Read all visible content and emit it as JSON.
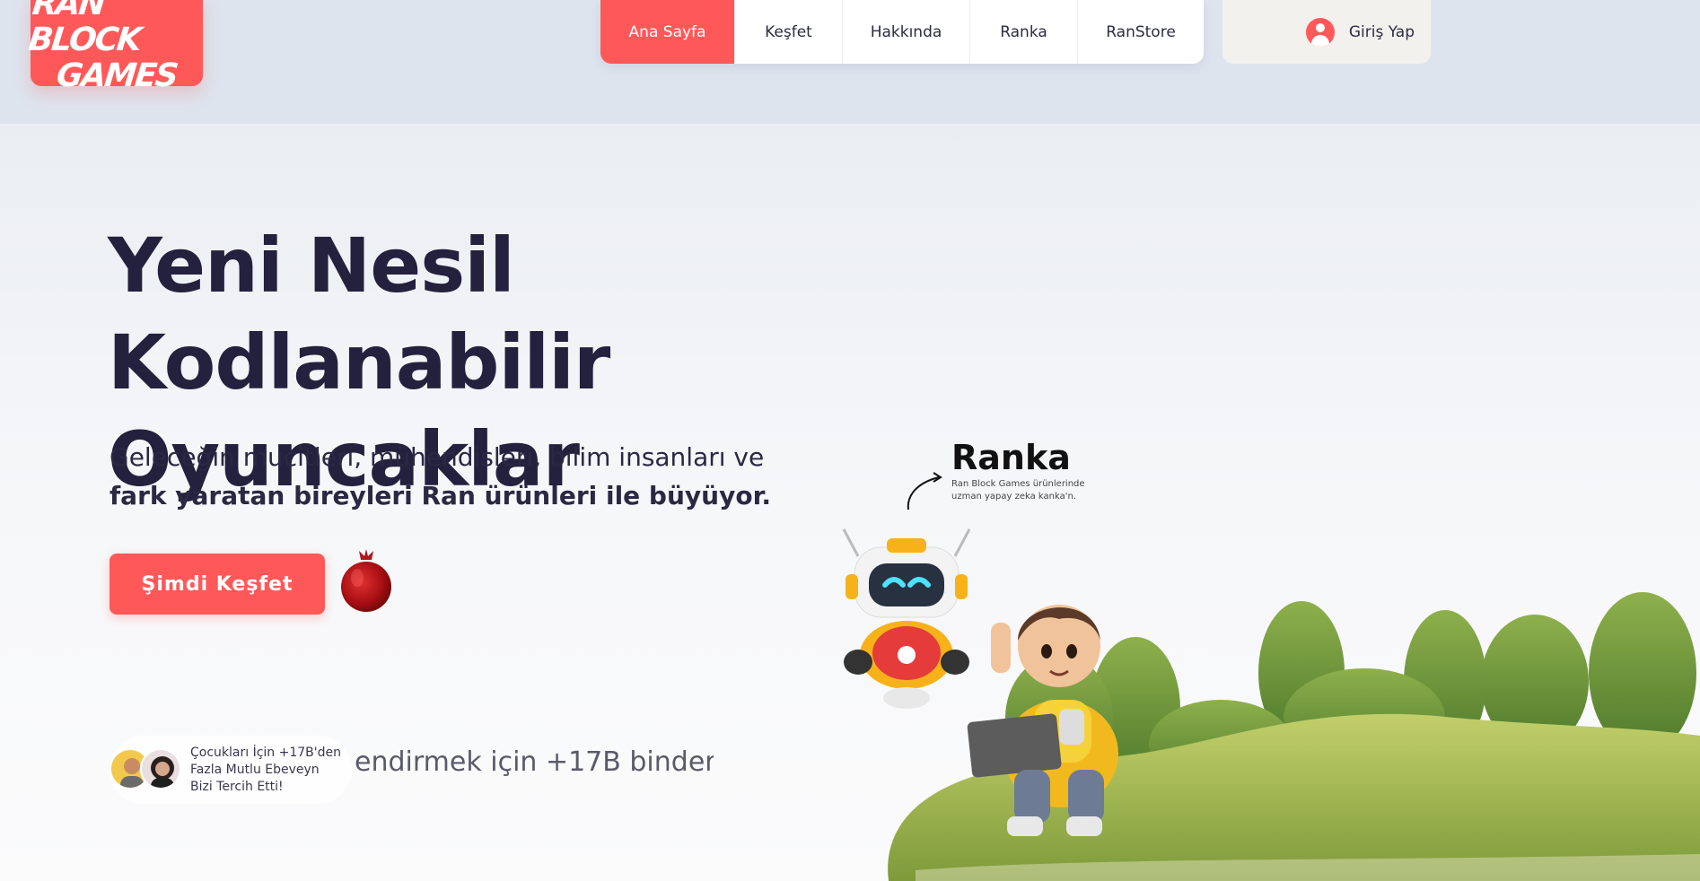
{
  "brand": {
    "line1": "RAN BLOCK",
    "line2": "GAMES"
  },
  "nav": {
    "items": [
      {
        "label": "Ana Sayfa",
        "active": true
      },
      {
        "label": "Keşfet",
        "active": false
      },
      {
        "label": "Hakkında",
        "active": false
      },
      {
        "label": "Ranka",
        "active": false
      },
      {
        "label": "RanStore",
        "active": false
      }
    ]
  },
  "login": {
    "label": "Giriş Yap",
    "icon": "user-icon"
  },
  "hero": {
    "title_line1": "Yeni Nesil Kodlanabilir",
    "title_line2": "Oyuncaklar",
    "subtitle_line1": "Geleceğin mucitleri, mühendisleri, bilim insanları ve",
    "subtitle_line2": "fark yaratan bireyleri Ran ürünleri ile büyüyor.",
    "cta_label": "Şimdi Keşfet"
  },
  "social_proof": {
    "line1": "Çocukları İçin +17B'den",
    "line2": "Fazla Mutlu Ebeveyn",
    "line3": "Bizi Tercih Etti!",
    "ticker": "endirmek için +17B binder"
  },
  "ranka": {
    "name": "Ranka",
    "desc_line1": "Ran Block Games ürünlerinde",
    "desc_line2": "uzman yapay zeka kanka'n."
  },
  "colors": {
    "accent": "#ff5858",
    "title": "#23213d",
    "nav_bg": "#ffffff",
    "band": "#dde4ee"
  }
}
